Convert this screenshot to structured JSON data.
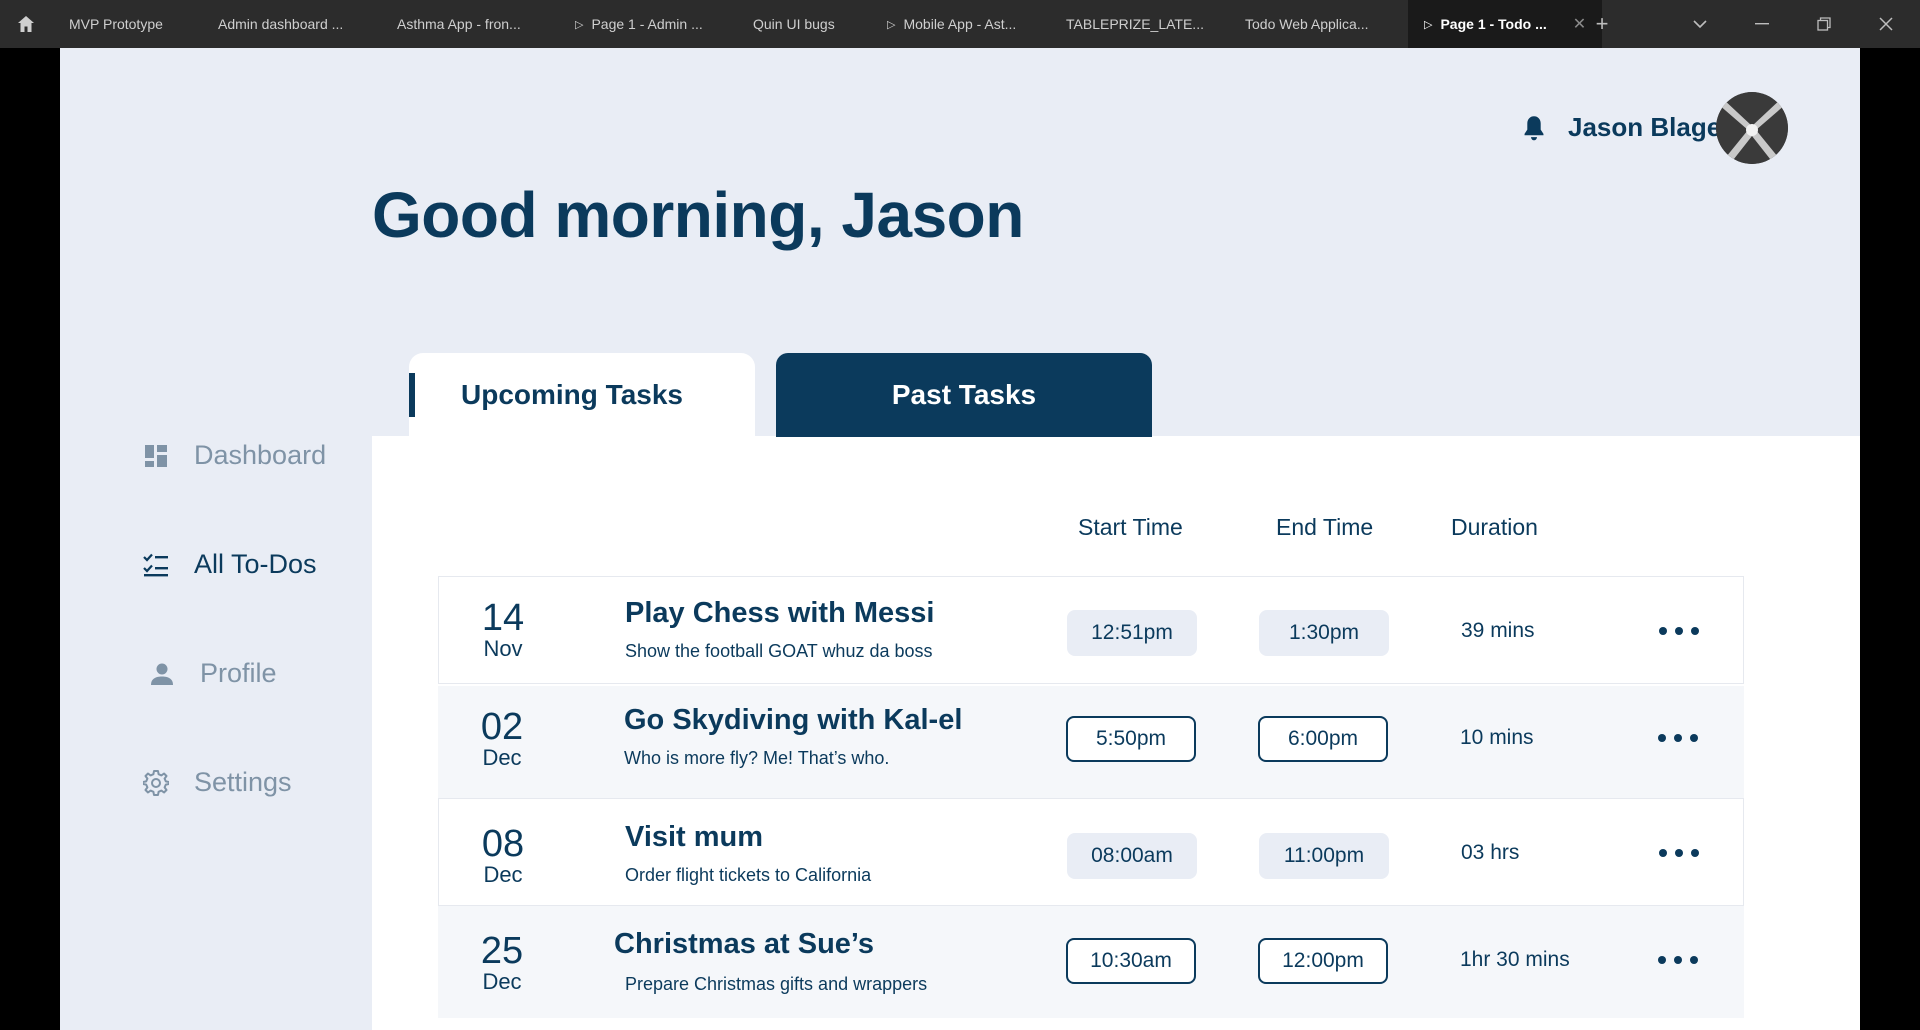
{
  "browser": {
    "tabs": [
      {
        "label": "MVP Prototype",
        "play": false
      },
      {
        "label": "Admin dashboard ...",
        "play": false
      },
      {
        "label": "Asthma App - fron...",
        "play": false
      },
      {
        "label": "Page 1 - Admin ...",
        "play": true
      },
      {
        "label": "Quin UI bugs",
        "play": false
      },
      {
        "label": "Mobile App - Ast...",
        "play": true
      },
      {
        "label": "TABLEPRIZE_LATE...",
        "play": false
      },
      {
        "label": "Todo Web Applica...",
        "play": false
      },
      {
        "label": "Page 1 - Todo ...",
        "play": true,
        "active": true
      }
    ]
  },
  "header": {
    "user_name": "Jason Blage",
    "greeting": "Good morning, Jason"
  },
  "sidebar": {
    "items": [
      {
        "label": "Dashboard",
        "icon": "dashboard-icon",
        "active": false
      },
      {
        "label": "All To-Dos",
        "icon": "checklist-icon",
        "active": true
      },
      {
        "label": "Profile",
        "icon": "person-icon",
        "active": false
      },
      {
        "label": "Settings",
        "icon": "gear-icon",
        "active": false
      }
    ]
  },
  "tabs": {
    "upcoming": "Upcoming Tasks",
    "past": "Past Tasks"
  },
  "table": {
    "headers": {
      "start": "Start Time",
      "end": "End Time",
      "duration": "Duration"
    },
    "rows": [
      {
        "day": "14",
        "month": "Nov",
        "title": "Play Chess with Messi",
        "desc": "Show the football GOAT whuz da boss",
        "start": "12:51pm",
        "end": "1:30pm",
        "duration": "39 mins",
        "pill_style": "filled"
      },
      {
        "day": "02",
        "month": "Dec",
        "title": "Go Skydiving with Kal-el",
        "desc": "Who is more fly? Me! That’s who.",
        "start": "5:50pm",
        "end": "6:00pm",
        "duration": "10 mins",
        "pill_style": "outline"
      },
      {
        "day": "08",
        "month": "Dec",
        "title": "Visit mum",
        "desc": "Order flight tickets to California",
        "start": "08:00am",
        "end": "11:00pm",
        "duration": "03 hrs",
        "pill_style": "filled"
      },
      {
        "day": "25",
        "month": "Dec",
        "title": "Christmas at Sue’s",
        "desc": "Prepare Christmas gifts and wrappers",
        "start": "10:30am",
        "end": "12:00pm",
        "duration": "1hr 30 mins",
        "pill_style": "outline"
      }
    ]
  },
  "colors": {
    "primary": "#0b3a5c",
    "background": "#e9edf5",
    "muted_nav": "#7f93a6"
  }
}
